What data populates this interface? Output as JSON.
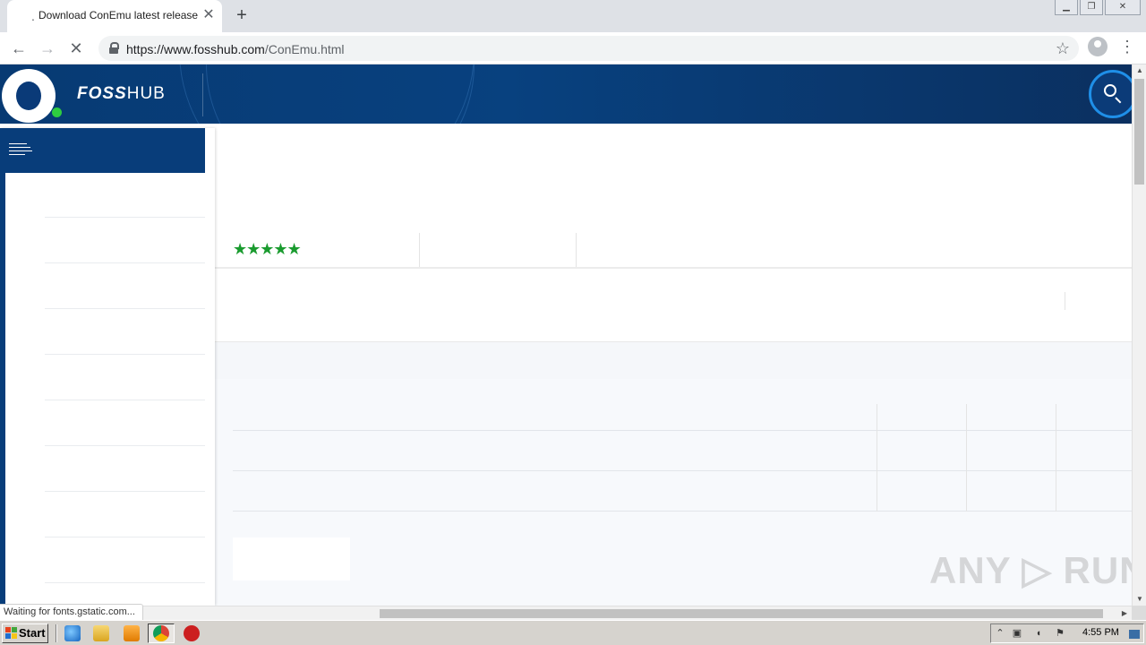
{
  "browser": {
    "tab_title": "Download ConEmu latest release",
    "tab_spinner_icon": "loading-spinner-icon",
    "new_tab_glyph": "+",
    "close_glyph": "✕",
    "url_host": "https://www.fosshub.com",
    "url_path": "/ConEmu.html",
    "status_text": "Waiting for fonts.gstatic.com..."
  },
  "site": {
    "logo_bold": "FOSS",
    "logo_light": "HUB",
    "rating_stars": "★★★★★",
    "accent_color": "#083d7a",
    "star_color": "#1a9b2f"
  },
  "watermark": "ANY ▷ RUN",
  "taskbar": {
    "start_label": "Start",
    "clock": "4:55 PM"
  }
}
